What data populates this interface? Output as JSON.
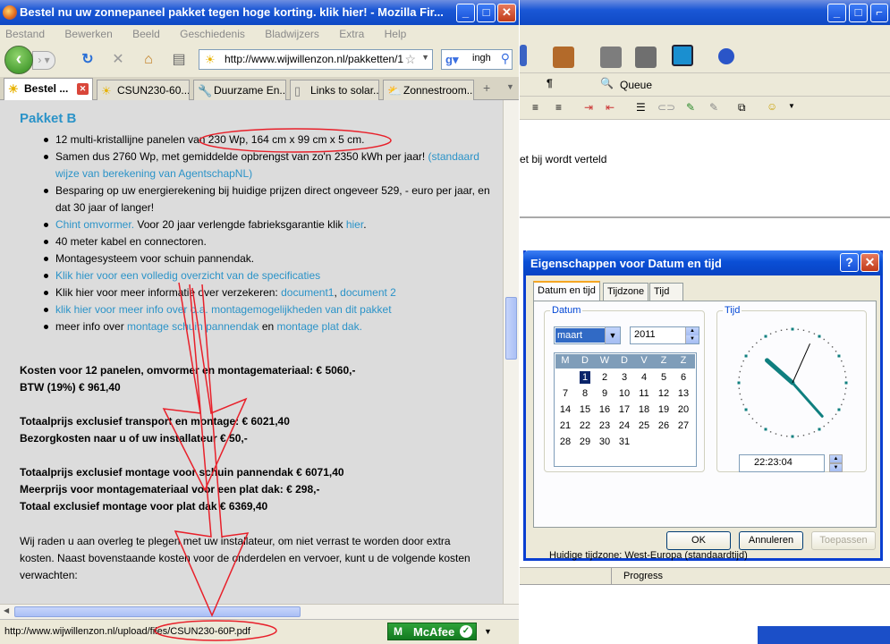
{
  "firefox": {
    "title": "Bestel nu uw zonnepaneel pakket tegen hoge korting. klik hier! - Mozilla Fir...",
    "menu": [
      "Bestand",
      "Bewerken",
      "Beeld",
      "Geschiedenis",
      "Bladwijzers",
      "Extra",
      "Help"
    ],
    "url": "http://www.wijwillenzon.nl/pakketten/1",
    "search_value": "ingh",
    "tabs": [
      {
        "label": "Bestel ...",
        "icon": "sun-icon"
      },
      {
        "label": "CSUN230-60...",
        "icon": "sun-icon"
      },
      {
        "label": "Duurzame En...",
        "icon": "wrench-icon"
      },
      {
        "label": "Links to solar...",
        "icon": "page-icon"
      },
      {
        "label": "Zonnestroom...",
        "icon": "weather-icon"
      }
    ],
    "new_tab_glyph": "+",
    "status_url": "http://www.wijwillenzon.nl/upload/files/CSUN230-60P.pdf",
    "mcafee_label": "McAfee"
  },
  "page": {
    "heading": "Pakket B",
    "bullets": [
      {
        "text": "12 multi-kristallijne panelen van 230 Wp, 164 cm x 99 cm x 5 cm.",
        "link": ""
      },
      {
        "text": "Samen dus 2760 Wp, met gemiddelde opbrengst van zo'n 2350 kWh per jaar! ",
        "link": "(standaard wijze van berekening van AgentschapNL)"
      },
      {
        "text": "Besparing op uw energierekening bij huidige prijzen direct ongeveer 529, - euro per jaar, en dat 30 jaar of langer!",
        "link": ""
      },
      {
        "link1": "Chint omvormer.",
        "text": " Voor 20 jaar verlengde fabrieksgarantie klik ",
        "link2": "hier",
        "tail": "."
      },
      {
        "text": "40 meter kabel en connectoren.",
        "link": ""
      },
      {
        "text": "Montagesysteem voor schuin pannendak.",
        "link": ""
      },
      {
        "link": "Klik hier voor een volledig overzicht van de specificaties"
      },
      {
        "text": "Klik hier voor meer informatie over verzekeren: ",
        "link1": "document1",
        "sep": ", ",
        "link2": "document 2"
      },
      {
        "link": "klik hier voor meer info over o.a. montagemogelijkheden van dit pakket"
      },
      {
        "text": "meer info over ",
        "link1": "montage schuin pannendak",
        "mid": " en ",
        "link2": "montage plat dak."
      }
    ],
    "costs": [
      "Kosten voor 12 panelen, omvormer en montagemateriaal: € 5060,-",
      "BTW (19%) € 961,40",
      "Totaalprijs exclusief transport en montage: €  6021,40",
      "Bezorgkosten naar u of uw installateur € 50,-",
      "Totaalprijs exclusief montage voor schuin pannendak € 6071,40",
      "Meerprijs voor montagemateriaal voor een plat dak: € 298,-",
      "Totaal exclusief montage voor plat dak € 6369,40"
    ],
    "paragraph": "Wij raden u aan overleg te plegen met uw installateur, om niet verrast te worden door extra kosten. Naast bovenstaande kosten voor de onderdelen en vervoer, kunt u de volgende kosten verwachten:"
  },
  "word": {
    "queue_label": "Queue",
    "doc_text": "et bij wordt verteld",
    "progress_label": "Progress"
  },
  "dialog": {
    "title": "Eigenschappen voor Datum en tijd",
    "tabs": [
      "Datum en tijd",
      "Tijdzone",
      "Tijd"
    ],
    "date_group": "Datum",
    "time_group": "Tijd",
    "month": "maart",
    "year": "2011",
    "weekdays": [
      "M",
      "D",
      "W",
      "D",
      "V",
      "Z",
      "Z"
    ],
    "days": [
      "1",
      "2",
      "3",
      "4",
      "5",
      "6",
      "7",
      "8",
      "9",
      "10",
      "11",
      "12",
      "13",
      "14",
      "15",
      "16",
      "17",
      "18",
      "19",
      "20",
      "21",
      "22",
      "23",
      "24",
      "25",
      "26",
      "27",
      "28",
      "29",
      "30",
      "31"
    ],
    "selected_day": "1",
    "time": "22:23:04",
    "timezone": "Huidige tijdzone: West-Europa (standaardtijd)",
    "buttons": {
      "ok": "OK",
      "cancel": "Annuleren",
      "apply": "Toepassen"
    }
  },
  "colors": {
    "link": "#2b93c8",
    "annotation": "#e8202a",
    "xp_blue": "#0a4fd6"
  }
}
